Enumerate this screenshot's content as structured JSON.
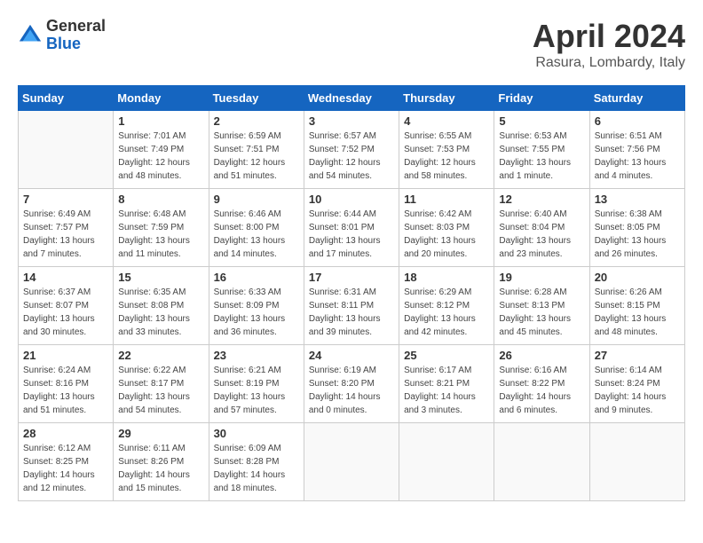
{
  "logo": {
    "general": "General",
    "blue": "Blue"
  },
  "title": "April 2024",
  "location": "Rasura, Lombardy, Italy",
  "days_of_week": [
    "Sunday",
    "Monday",
    "Tuesday",
    "Wednesday",
    "Thursday",
    "Friday",
    "Saturday"
  ],
  "weeks": [
    [
      {
        "day": "",
        "sunrise": "",
        "sunset": "",
        "daylight": ""
      },
      {
        "day": "1",
        "sunrise": "Sunrise: 7:01 AM",
        "sunset": "Sunset: 7:49 PM",
        "daylight": "Daylight: 12 hours and 48 minutes."
      },
      {
        "day": "2",
        "sunrise": "Sunrise: 6:59 AM",
        "sunset": "Sunset: 7:51 PM",
        "daylight": "Daylight: 12 hours and 51 minutes."
      },
      {
        "day": "3",
        "sunrise": "Sunrise: 6:57 AM",
        "sunset": "Sunset: 7:52 PM",
        "daylight": "Daylight: 12 hours and 54 minutes."
      },
      {
        "day": "4",
        "sunrise": "Sunrise: 6:55 AM",
        "sunset": "Sunset: 7:53 PM",
        "daylight": "Daylight: 12 hours and 58 minutes."
      },
      {
        "day": "5",
        "sunrise": "Sunrise: 6:53 AM",
        "sunset": "Sunset: 7:55 PM",
        "daylight": "Daylight: 13 hours and 1 minute."
      },
      {
        "day": "6",
        "sunrise": "Sunrise: 6:51 AM",
        "sunset": "Sunset: 7:56 PM",
        "daylight": "Daylight: 13 hours and 4 minutes."
      }
    ],
    [
      {
        "day": "7",
        "sunrise": "Sunrise: 6:49 AM",
        "sunset": "Sunset: 7:57 PM",
        "daylight": "Daylight: 13 hours and 7 minutes."
      },
      {
        "day": "8",
        "sunrise": "Sunrise: 6:48 AM",
        "sunset": "Sunset: 7:59 PM",
        "daylight": "Daylight: 13 hours and 11 minutes."
      },
      {
        "day": "9",
        "sunrise": "Sunrise: 6:46 AM",
        "sunset": "Sunset: 8:00 PM",
        "daylight": "Daylight: 13 hours and 14 minutes."
      },
      {
        "day": "10",
        "sunrise": "Sunrise: 6:44 AM",
        "sunset": "Sunset: 8:01 PM",
        "daylight": "Daylight: 13 hours and 17 minutes."
      },
      {
        "day": "11",
        "sunrise": "Sunrise: 6:42 AM",
        "sunset": "Sunset: 8:03 PM",
        "daylight": "Daylight: 13 hours and 20 minutes."
      },
      {
        "day": "12",
        "sunrise": "Sunrise: 6:40 AM",
        "sunset": "Sunset: 8:04 PM",
        "daylight": "Daylight: 13 hours and 23 minutes."
      },
      {
        "day": "13",
        "sunrise": "Sunrise: 6:38 AM",
        "sunset": "Sunset: 8:05 PM",
        "daylight": "Daylight: 13 hours and 26 minutes."
      }
    ],
    [
      {
        "day": "14",
        "sunrise": "Sunrise: 6:37 AM",
        "sunset": "Sunset: 8:07 PM",
        "daylight": "Daylight: 13 hours and 30 minutes."
      },
      {
        "day": "15",
        "sunrise": "Sunrise: 6:35 AM",
        "sunset": "Sunset: 8:08 PM",
        "daylight": "Daylight: 13 hours and 33 minutes."
      },
      {
        "day": "16",
        "sunrise": "Sunrise: 6:33 AM",
        "sunset": "Sunset: 8:09 PM",
        "daylight": "Daylight: 13 hours and 36 minutes."
      },
      {
        "day": "17",
        "sunrise": "Sunrise: 6:31 AM",
        "sunset": "Sunset: 8:11 PM",
        "daylight": "Daylight: 13 hours and 39 minutes."
      },
      {
        "day": "18",
        "sunrise": "Sunrise: 6:29 AM",
        "sunset": "Sunset: 8:12 PM",
        "daylight": "Daylight: 13 hours and 42 minutes."
      },
      {
        "day": "19",
        "sunrise": "Sunrise: 6:28 AM",
        "sunset": "Sunset: 8:13 PM",
        "daylight": "Daylight: 13 hours and 45 minutes."
      },
      {
        "day": "20",
        "sunrise": "Sunrise: 6:26 AM",
        "sunset": "Sunset: 8:15 PM",
        "daylight": "Daylight: 13 hours and 48 minutes."
      }
    ],
    [
      {
        "day": "21",
        "sunrise": "Sunrise: 6:24 AM",
        "sunset": "Sunset: 8:16 PM",
        "daylight": "Daylight: 13 hours and 51 minutes."
      },
      {
        "day": "22",
        "sunrise": "Sunrise: 6:22 AM",
        "sunset": "Sunset: 8:17 PM",
        "daylight": "Daylight: 13 hours and 54 minutes."
      },
      {
        "day": "23",
        "sunrise": "Sunrise: 6:21 AM",
        "sunset": "Sunset: 8:19 PM",
        "daylight": "Daylight: 13 hours and 57 minutes."
      },
      {
        "day": "24",
        "sunrise": "Sunrise: 6:19 AM",
        "sunset": "Sunset: 8:20 PM",
        "daylight": "Daylight: 14 hours and 0 minutes."
      },
      {
        "day": "25",
        "sunrise": "Sunrise: 6:17 AM",
        "sunset": "Sunset: 8:21 PM",
        "daylight": "Daylight: 14 hours and 3 minutes."
      },
      {
        "day": "26",
        "sunrise": "Sunrise: 6:16 AM",
        "sunset": "Sunset: 8:22 PM",
        "daylight": "Daylight: 14 hours and 6 minutes."
      },
      {
        "day": "27",
        "sunrise": "Sunrise: 6:14 AM",
        "sunset": "Sunset: 8:24 PM",
        "daylight": "Daylight: 14 hours and 9 minutes."
      }
    ],
    [
      {
        "day": "28",
        "sunrise": "Sunrise: 6:12 AM",
        "sunset": "Sunset: 8:25 PM",
        "daylight": "Daylight: 14 hours and 12 minutes."
      },
      {
        "day": "29",
        "sunrise": "Sunrise: 6:11 AM",
        "sunset": "Sunset: 8:26 PM",
        "daylight": "Daylight: 14 hours and 15 minutes."
      },
      {
        "day": "30",
        "sunrise": "Sunrise: 6:09 AM",
        "sunset": "Sunset: 8:28 PM",
        "daylight": "Daylight: 14 hours and 18 minutes."
      },
      {
        "day": "",
        "sunrise": "",
        "sunset": "",
        "daylight": ""
      },
      {
        "day": "",
        "sunrise": "",
        "sunset": "",
        "daylight": ""
      },
      {
        "day": "",
        "sunrise": "",
        "sunset": "",
        "daylight": ""
      },
      {
        "day": "",
        "sunrise": "",
        "sunset": "",
        "daylight": ""
      }
    ]
  ]
}
